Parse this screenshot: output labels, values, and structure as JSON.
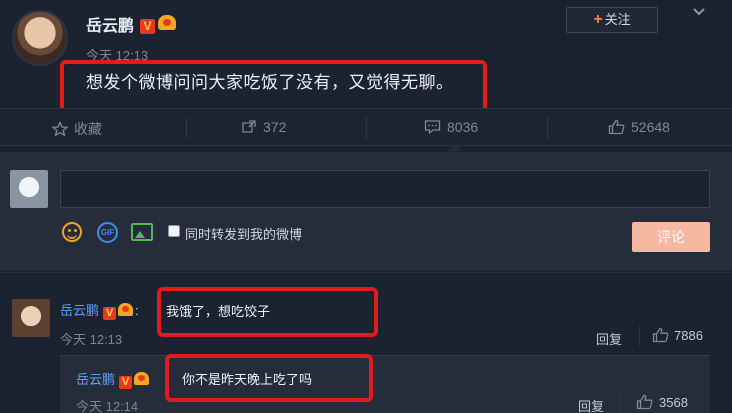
{
  "post": {
    "author": "岳云鹏",
    "verified_badge": "V",
    "time": "今天 12:13",
    "text": "想发个微博问问大家吃饭了没有，又觉得无聊。",
    "follow_label": "关注",
    "follow_icon": "+"
  },
  "actions": {
    "favorite_label": "收藏",
    "repost_count": "372",
    "comment_count": "8036",
    "like_count": "52648"
  },
  "composer": {
    "gif_icon_text": "GIF",
    "repost_checkbox_label": "同时转发到我的微博",
    "submit_label": "评论"
  },
  "comments": [
    {
      "author": "岳云鹏",
      "verified_badge": "V",
      "separator": ":",
      "text": "我饿了，想吃饺子",
      "time": "今天 12:13",
      "reply_label": "回复",
      "like_count": "7886",
      "reply": {
        "author": "岳云鹏",
        "verified_badge": "V",
        "text": "你不是昨天晚上吃了吗",
        "time": "今天 12:14",
        "reply_label": "回复",
        "like_count": "3568"
      }
    }
  ],
  "colors": {
    "background": "#1c2330",
    "highlight_box": "#e21c1c",
    "link": "#5ea0ff",
    "submit": "#f7b8a1",
    "follow_plus": "#ff8140"
  }
}
